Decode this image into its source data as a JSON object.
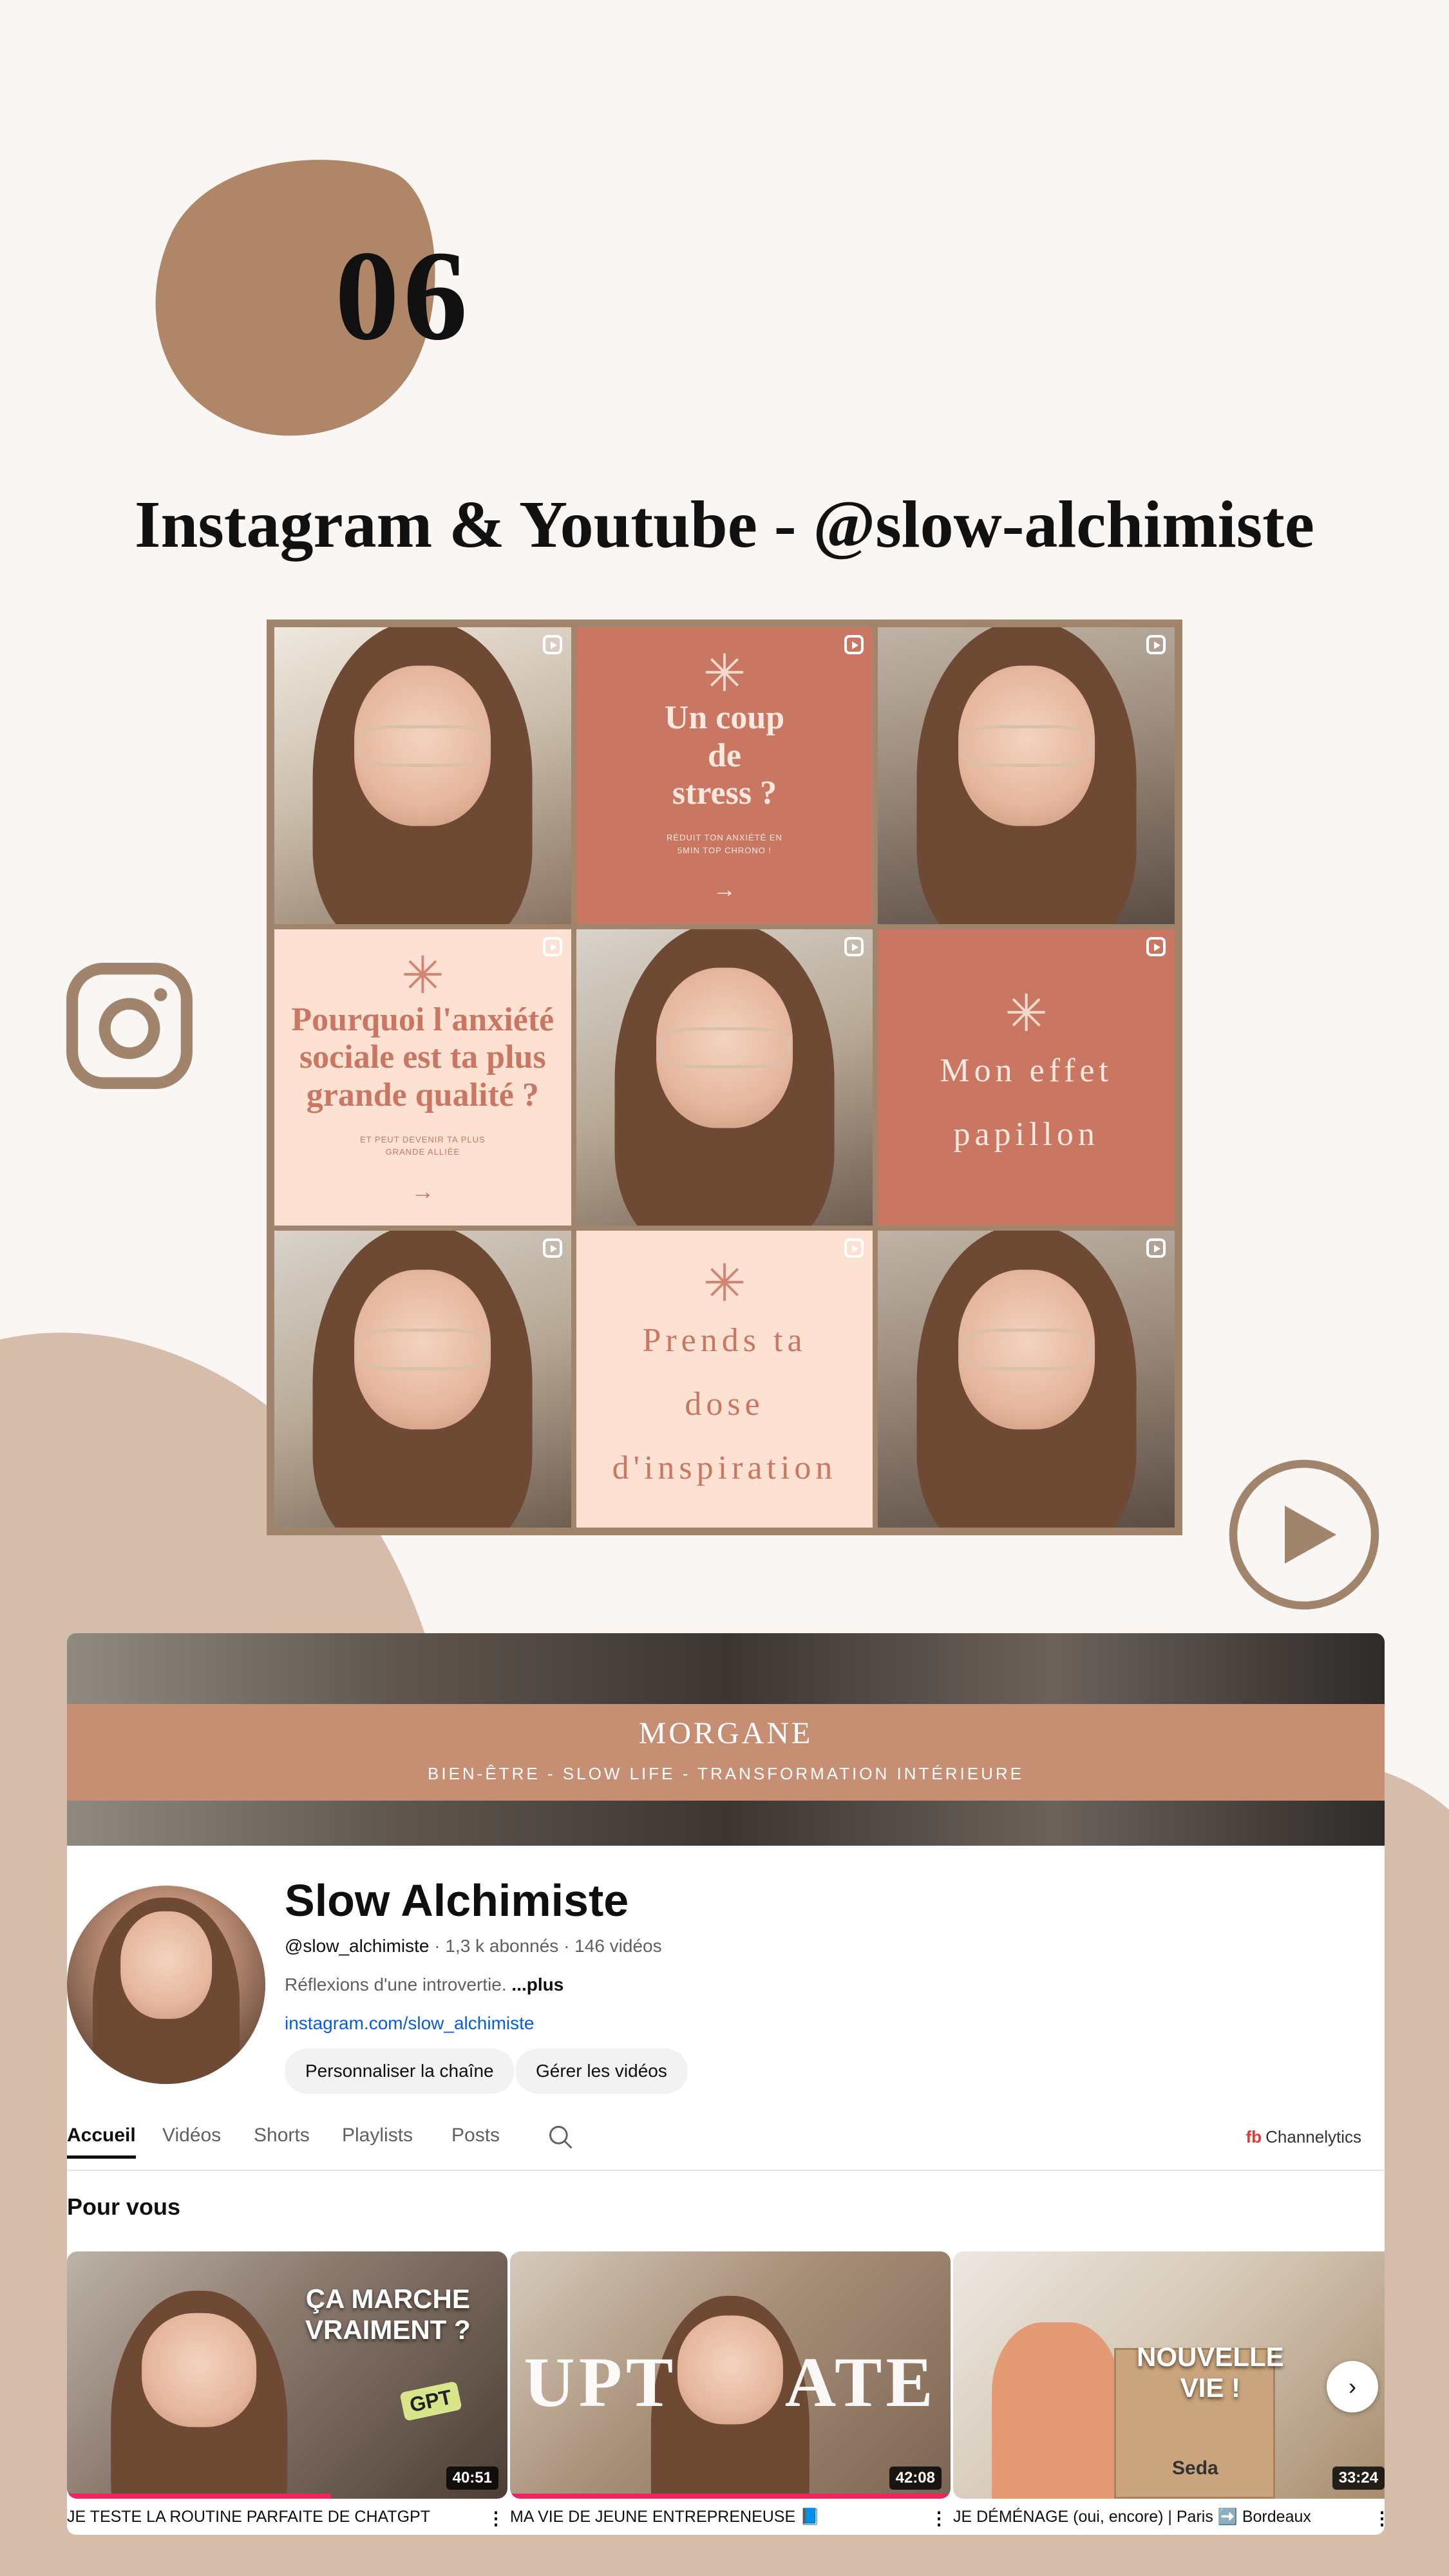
{
  "section_number": "06",
  "main_title": "Instagram & Youtube - @slow-alchimiste",
  "colors": {
    "accent": "#b08669",
    "light_accent": "#d5bcab",
    "terracotta": "#c97763",
    "peach": "#fde2d4"
  },
  "icons": {
    "left": "instagram-icon",
    "right": "play-circle-icon"
  },
  "instagram": {
    "tiles": [
      {
        "kind": "photo"
      },
      {
        "kind": "text",
        "title": "Un coup de stress ?",
        "line1": "Un coup",
        "line2": "de",
        "line3": "stress ?",
        "small1": "RÉDUIT TON ANXIÉTÉ EN",
        "small2": "5MIN TOP CHRONO !",
        "arrow": "→"
      },
      {
        "kind": "photo"
      },
      {
        "kind": "text",
        "line1": "Pourquoi l'anxiété",
        "line2": "sociale est ta plus",
        "line3": "grande qualité ?",
        "small1": "ET PEUT DEVENIR TA PLUS",
        "small2": "GRANDE ALLIÉE",
        "arrow": "→"
      },
      {
        "kind": "photo"
      },
      {
        "kind": "text",
        "line1": "Mon effet",
        "line2": "papillon"
      },
      {
        "kind": "photo"
      },
      {
        "kind": "text",
        "line1": "Prends ta",
        "line2": "dose",
        "line3": "d'inspiration"
      },
      {
        "kind": "photo"
      }
    ]
  },
  "youtube": {
    "banner_brand": "MORGANE",
    "banner_tagline": "BIEN-ÊTRE - SLOW LIFE - TRANSFORMATION INTÉRIEURE",
    "channel_name": "Slow Alchimiste",
    "handle": "@slow_alchimiste",
    "stats": "· 1,3 k abonnés · 146 vidéos",
    "description": "Réflexions d'une introvertie.",
    "description_more": "...plus",
    "link": "instagram.com/slow_alchimiste",
    "buttons": {
      "customize": "Personnaliser la chaîne",
      "manage": "Gérer les vidéos"
    },
    "tabs": [
      "Accueil",
      "Vidéos",
      "Shorts",
      "Playlists",
      "Posts"
    ],
    "channelytics": {
      "mark": "fb",
      "label": "Channelytics"
    },
    "section_title": "Pour vous",
    "videos": [
      {
        "title": "JE TESTE LA ROUTINE PARFAITE DE CHATGPT",
        "duration": "40:51",
        "thumb_text1": "ÇA MARCHE",
        "thumb_text2": "VRAIMENT ?",
        "thumb_badge": "GPT",
        "progress": 0.6
      },
      {
        "title": "MA VIE DE JEUNE ENTREPRENEUSE 📘",
        "duration": "42:08",
        "thumb_text1": "UPT",
        "thumb_text2": "ATE",
        "progress": 1.0
      },
      {
        "title": "JE DÉMÉNAGE (oui, encore) | Paris ➡️ Bordeaux",
        "duration": "33:24",
        "thumb_text1": "NOUVELLE",
        "thumb_text2": "VIE !",
        "thumb_badge": "Seda",
        "progress": 0
      }
    ],
    "kebab": "⋮",
    "next_arrow": "›"
  }
}
